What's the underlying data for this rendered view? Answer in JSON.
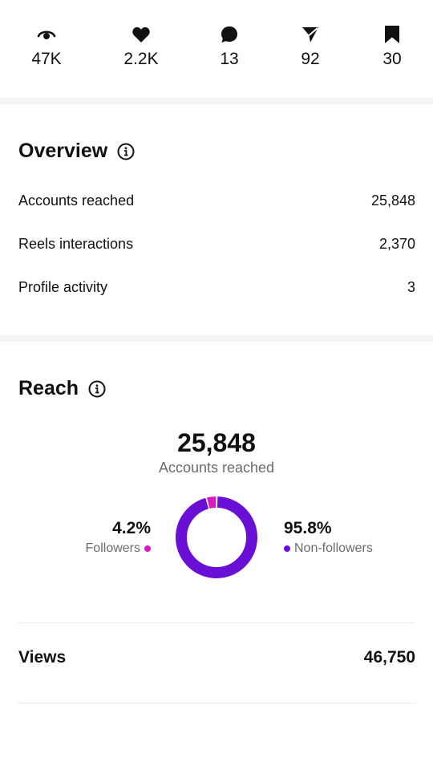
{
  "stats": [
    {
      "icon": "eye-icon",
      "value": "47K"
    },
    {
      "icon": "heart-icon",
      "value": "2.2K"
    },
    {
      "icon": "comment-icon",
      "value": "13"
    },
    {
      "icon": "share-icon",
      "value": "92"
    },
    {
      "icon": "bookmark-icon",
      "value": "30"
    }
  ],
  "overview": {
    "title": "Overview",
    "rows": [
      {
        "label": "Accounts reached",
        "value": "25,848"
      },
      {
        "label": "Reels interactions",
        "value": "2,370"
      },
      {
        "label": "Profile activity",
        "value": "3"
      }
    ]
  },
  "reach": {
    "title": "Reach",
    "total": "25,848",
    "total_label": "Accounts reached",
    "followers": {
      "percent": "4.2%",
      "label": "Followers",
      "fraction": 0.042,
      "color": "#d81bbf"
    },
    "non_followers": {
      "percent": "95.8%",
      "label": "Non-followers",
      "fraction": 0.958,
      "color": "#6a0fd6"
    }
  },
  "views": {
    "label": "Views",
    "value": "46,750"
  }
}
